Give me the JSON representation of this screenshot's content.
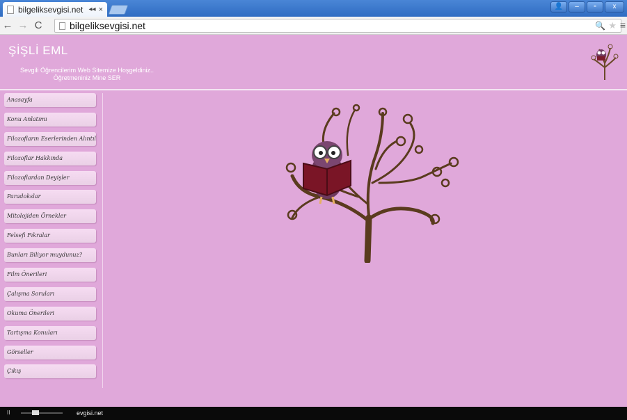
{
  "browser": {
    "tab_title": "bilgeliksevgisi.net",
    "tab_audio": "◂◂",
    "tab_close": "×",
    "url": "bilgeliksevgisi.net"
  },
  "site": {
    "title": "ŞİŞLİ EML",
    "welcome_line1": "Sevgili Öğrencilerim Web Sitemize Hoşgeldiniz..",
    "welcome_line2": "Öğretmeniniz Mine SER"
  },
  "sidebar": {
    "items": [
      {
        "label": "Anasayfa"
      },
      {
        "label": "Konu Anlatımı"
      },
      {
        "label": "Filozofların Eserlerinden Alıntılar"
      },
      {
        "label": "Filozoflar Hakkında"
      },
      {
        "label": "Filozoflardan Deyişler"
      },
      {
        "label": "Paradokslar"
      },
      {
        "label": "Mitolojiden Örnekler"
      },
      {
        "label": "Felsefi Fıkralar"
      },
      {
        "label": "Bunları Biliyor muydunuz?"
      },
      {
        "label": "Film Önerileri"
      },
      {
        "label": "Çalışma Soruları"
      },
      {
        "label": "Okuma Önerileri"
      },
      {
        "label": "Tartışma Konuları"
      },
      {
        "label": "Görseller"
      },
      {
        "label": "Çıkış"
      }
    ]
  },
  "status": {
    "text": "evgisi.net"
  },
  "colors": {
    "page_bg": "#e0a8da",
    "chrome_blue": "#3a77cc"
  }
}
